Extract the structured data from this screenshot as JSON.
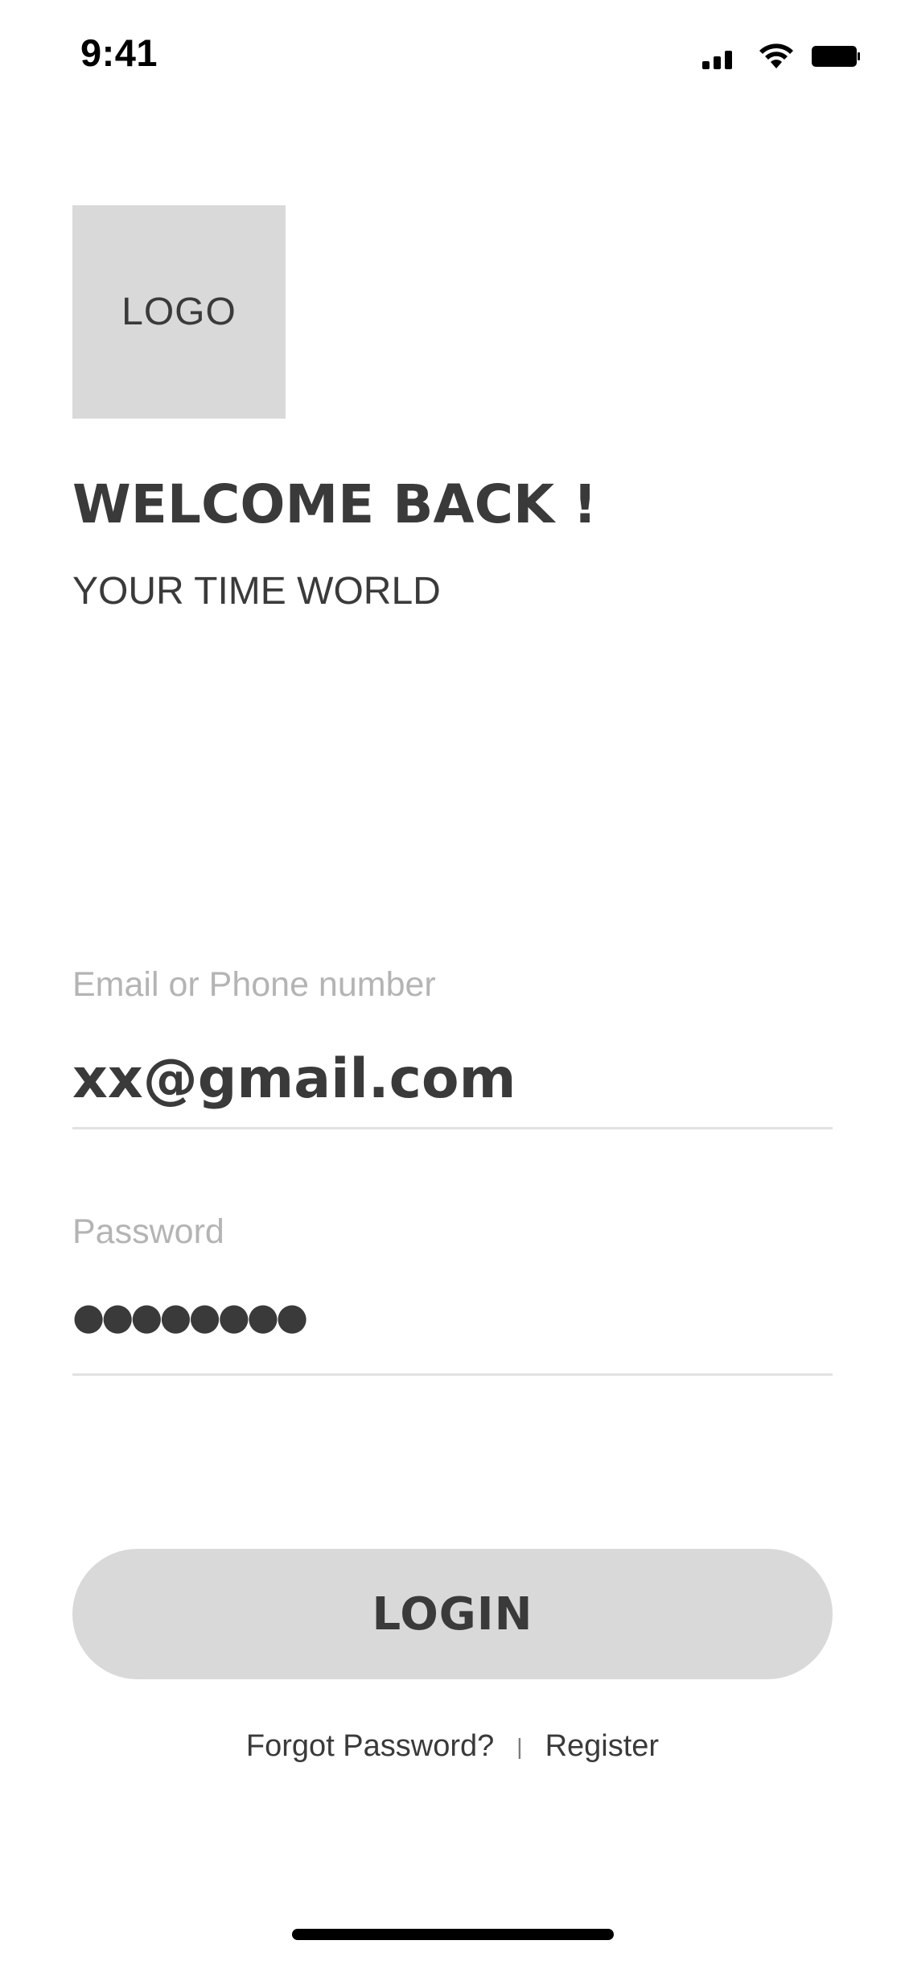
{
  "status_bar": {
    "time": "9:41",
    "icons": [
      "signal-icon",
      "wifi-icon",
      "battery-icon"
    ]
  },
  "logo": {
    "text": "LOGO",
    "background": "#d9d9d9"
  },
  "welcome": {
    "title": "WELCOME BACK !",
    "subtitle": "YOUR TIME WORLD"
  },
  "form": {
    "email": {
      "label": "Email or Phone number",
      "value": "xx@gmail.com"
    },
    "password": {
      "label": "Password",
      "value": "●●●●●●●●"
    }
  },
  "login_button": {
    "label": "LOGIN",
    "background": "#d9d9d9"
  },
  "footer": {
    "forgot_password": "Forgot Password?",
    "divider": "|",
    "register": "Register"
  },
  "colors": {
    "text": "#3a3a3a",
    "label": "#b4b4b4",
    "underline": "#e2e2e2"
  }
}
